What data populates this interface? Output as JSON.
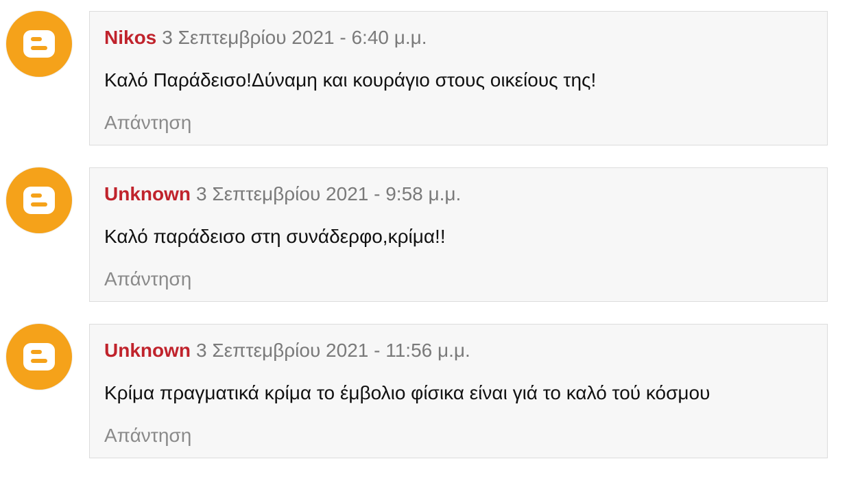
{
  "colors": {
    "author": "#c0232c",
    "timestamp": "#7a7a7a",
    "reply": "#8a8a8a",
    "avatar_bg": "#f5a21a",
    "box_bg": "#f7f7f7",
    "box_border": "#dcdcdc"
  },
  "comments": [
    {
      "avatar_icon": "blogger-icon",
      "author": "Nikos",
      "timestamp": "3 Σεπτεμβρίου 2021 - 6:40 μ.μ.",
      "body": "Καλό Παράδεισο!Δύναμη και κουράγιο στους οικείους της!",
      "reply_label": "Απάντηση"
    },
    {
      "avatar_icon": "blogger-icon",
      "author": "Unknown",
      "timestamp": "3 Σεπτεμβρίου 2021 - 9:58 μ.μ.",
      "body": "Καλό παράδεισο στη συνάδερφο,κρίμα!!",
      "reply_label": "Απάντηση"
    },
    {
      "avatar_icon": "blogger-icon",
      "author": "Unknown",
      "timestamp": "3 Σεπτεμβρίου 2021 - 11:56 μ.μ.",
      "body": "Κρίμα πραγματικά κρίμα το έμβολιο φίσικα είναι γιά το καλό τού κόσμου",
      "reply_label": "Απάντηση"
    }
  ]
}
